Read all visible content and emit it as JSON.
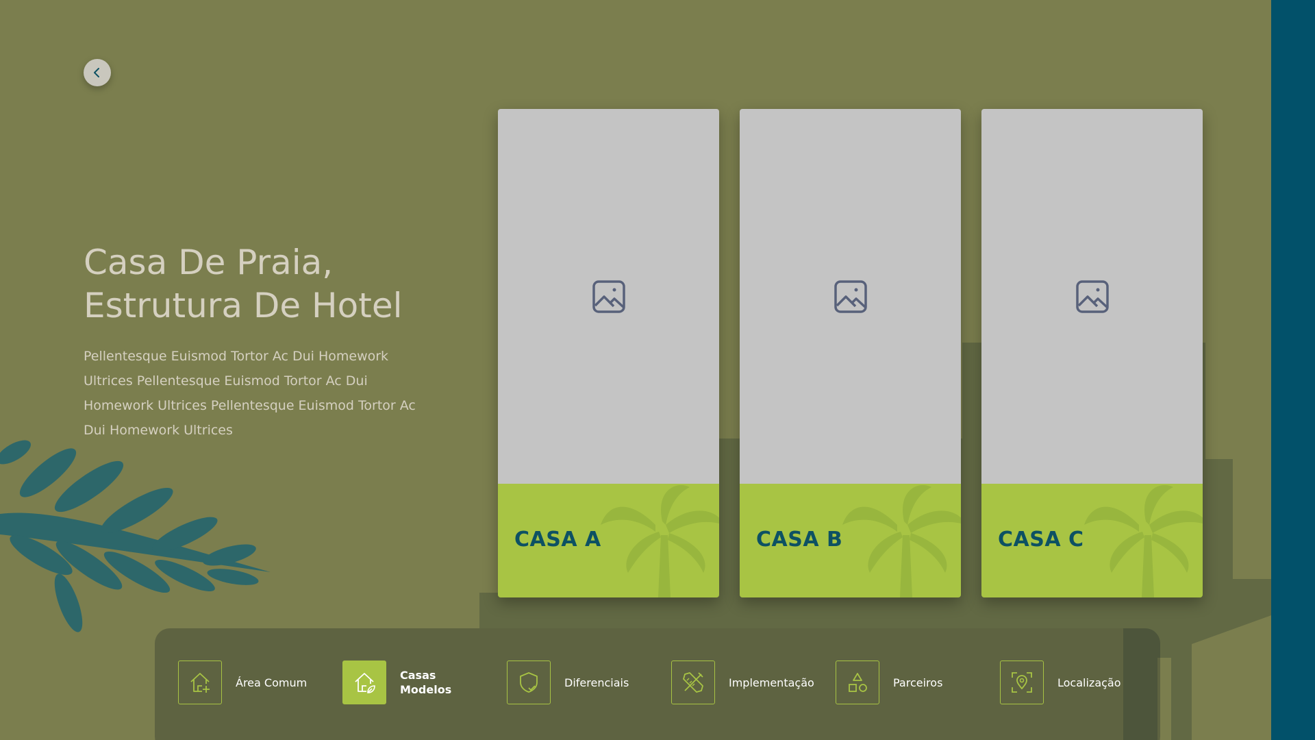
{
  "hero": {
    "title_line1": "Casa De Praia,",
    "title_line2": "Estrutura De Hotel",
    "description": "Pellentesque Euismod Tortor Ac Dui Homework Ultrices Pellentesque Euismod Tortor Ac Dui Homework Ultrices Pellentesque Euismod Tortor Ac Dui Homework Ultrices"
  },
  "back_button": {
    "icon": "chevron-left-icon"
  },
  "cards": [
    {
      "label": "CASA A",
      "image_icon": "image-placeholder-icon"
    },
    {
      "label": "CASA B",
      "image_icon": "image-placeholder-icon"
    },
    {
      "label": "CASA C",
      "image_icon": "image-placeholder-icon"
    }
  ],
  "nav": {
    "items": [
      {
        "label": "Área Comum",
        "icon": "house-plus-icon",
        "active": false
      },
      {
        "label_line1": "Casas",
        "label_line2": "Modelos",
        "icon": "house-leaf-icon",
        "active": true
      },
      {
        "label": "Diferenciais",
        "icon": "shield-check-icon",
        "active": false
      },
      {
        "label": "Implementação",
        "icon": "tools-icon",
        "active": false
      },
      {
        "label": "Parceiros",
        "icon": "shapes-icon",
        "active": false
      },
      {
        "label": "Localização",
        "icon": "location-pin-icon",
        "active": false
      }
    ]
  },
  "colors": {
    "background": "#7b7e4e",
    "accent_green": "#a8c444",
    "dark_teal": "#02516a",
    "card_label": "#0d5163",
    "placeholder_gray": "#c4c4c4"
  }
}
